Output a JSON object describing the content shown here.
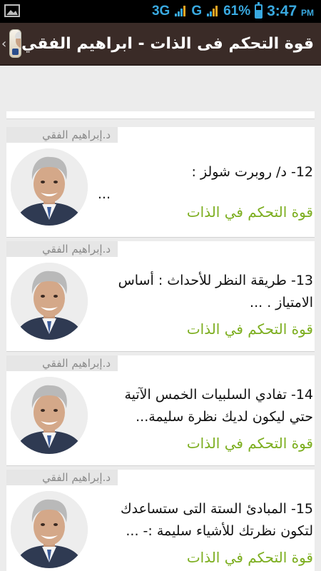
{
  "status_bar": {
    "network_1": "3G",
    "network_2": "G",
    "battery": "61%",
    "battery_level": 0.61,
    "time": "3:47",
    "ampm": "PM"
  },
  "action_bar": {
    "title": "قوة التحكم فى الذات - ابراهيم الفقي",
    "icon": "app-book-cover-icon"
  },
  "list": {
    "items": [
      {
        "author": "د.إبراهيم الفقي",
        "title_line1": "12- د/ روبرت شولز :",
        "title_line2": "...",
        "category": "قوة التحكم في الذات"
      },
      {
        "author": "د.إبراهيم الفقي",
        "title_line1": "13- طريقة النظر للأحداث : أساس",
        "title_line2": "الامتياز . ...",
        "category": "قوة التحكم في الذات"
      },
      {
        "author": "د.إبراهيم الفقي",
        "title_line1": "14- تفادي السلبيات الخمس الآتية",
        "title_line2": "حتي ليكون لديك نظرة سليمة...",
        "category": "قوة التحكم في الذات"
      },
      {
        "author": "د.إبراهيم الفقي",
        "title_line1": "15- المبادئ الستة التى ستساعدك",
        "title_line2": "لتكون نظرتك للأشياء سليمة :- ...",
        "category": "قوة التحكم في الذات"
      }
    ]
  },
  "colors": {
    "status_bar_bg": "#000000",
    "status_icons": "#39a9e0",
    "action_bar_bg": "#3a2b27",
    "category_green": "#7cae1f",
    "author_tag_bg": "#e6e6e6"
  }
}
